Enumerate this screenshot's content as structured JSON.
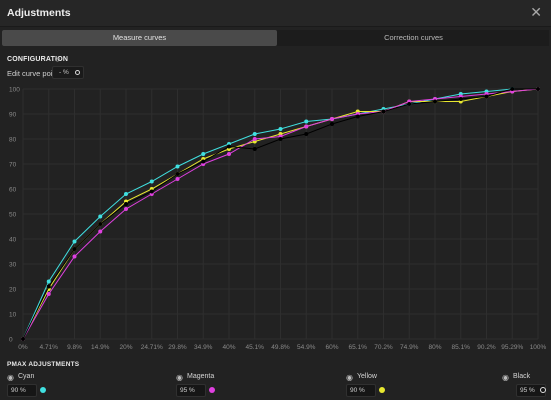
{
  "window": {
    "title": "Adjustments"
  },
  "tabs": [
    {
      "label": "Measure curves",
      "active": true
    },
    {
      "label": "Correction curves",
      "active": false
    }
  ],
  "configuration": {
    "title": "CONFIGURATION",
    "edit_label": "Edit curve point",
    "edit_value": "- %"
  },
  "pmax": {
    "title": "PMAX ADJUSTMENTS",
    "inks": [
      {
        "name": "Cyan",
        "value": "90 %",
        "color": "#40e0e0"
      },
      {
        "name": "Magenta",
        "value": "95 %",
        "color": "#e040e0"
      },
      {
        "name": "Yellow",
        "value": "90 %",
        "color": "#e8e830"
      },
      {
        "name": "Black",
        "value": "95 %",
        "color": "#000000"
      }
    ]
  },
  "chart_data": {
    "type": "line",
    "x": [
      "0%",
      "4.71%",
      "9.8%",
      "14.9%",
      "20%",
      "24.71%",
      "29.8%",
      "34.9%",
      "40%",
      "45.1%",
      "49.8%",
      "54.9%",
      "60%",
      "65.1%",
      "70.2%",
      "74.9%",
      "80%",
      "85.1%",
      "90.2%",
      "95.29%",
      "100%"
    ],
    "yticks": [
      0,
      10,
      20,
      30,
      40,
      50,
      60,
      70,
      80,
      90,
      100
    ],
    "ylim": [
      0,
      100
    ],
    "grid": true,
    "series": [
      {
        "name": "Cyan",
        "color": "#40e0e0",
        "values": [
          0,
          23,
          39,
          49,
          58,
          63,
          69,
          74,
          78,
          82,
          84,
          87,
          88,
          90,
          92,
          94,
          96,
          98,
          99,
          100,
          100
        ]
      },
      {
        "name": "Yellow",
        "color": "#e8e830",
        "values": [
          0,
          20,
          36,
          46,
          55,
          60,
          66,
          72,
          76,
          79,
          82,
          85,
          88,
          91,
          91,
          95,
          95,
          95,
          97,
          99,
          100
        ]
      },
      {
        "name": "Magenta",
        "color": "#e040e0",
        "values": [
          0,
          18,
          33,
          43,
          52,
          58,
          64,
          70,
          74,
          80,
          81,
          85,
          88,
          90,
          91,
          95,
          96,
          97,
          98,
          99,
          100
        ]
      },
      {
        "name": "Black",
        "color": "#000000",
        "values": [
          0,
          21,
          36,
          46,
          54,
          59,
          66,
          71,
          77,
          76,
          80,
          82,
          86,
          89,
          91,
          94,
          95,
          96,
          97,
          100,
          100
        ]
      }
    ]
  }
}
